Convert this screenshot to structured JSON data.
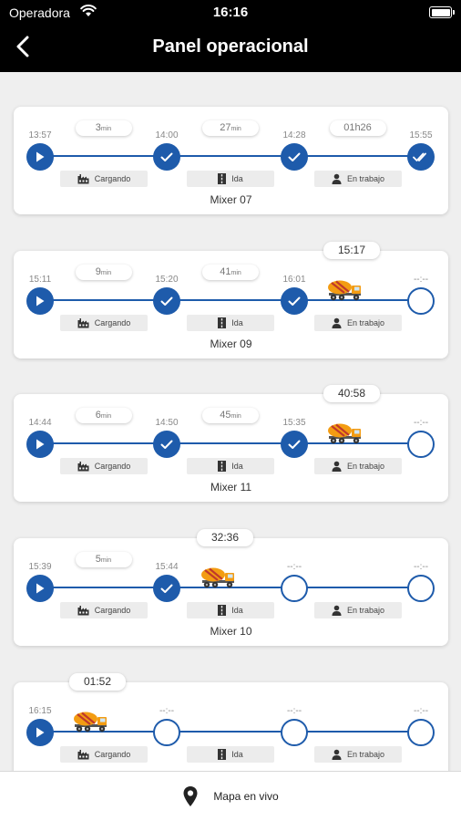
{
  "status_bar": {
    "carrier": "Operadora",
    "time": "16:16"
  },
  "header": {
    "title": "Panel operacional"
  },
  "cards": [
    {
      "mixer": "Mixer 07",
      "eta": "",
      "truck_stage": null,
      "times": [
        "13:57",
        "14:00",
        "14:28",
        "15:55"
      ],
      "durations": [
        {
          "value": "3",
          "unit": "min"
        },
        {
          "value": "27",
          "unit": "min"
        },
        {
          "value": "01h26",
          "unit": ""
        }
      ],
      "nodes": [
        "play",
        "check",
        "check",
        "double-check"
      ],
      "stages": [
        "Cargando",
        "Ida",
        "En trabajo"
      ]
    },
    {
      "mixer": "Mixer 09",
      "eta": "15:17",
      "truck_stage": 2,
      "times": [
        "15:11",
        "15:20",
        "16:01",
        "--:--"
      ],
      "durations": [
        {
          "value": "9",
          "unit": "min"
        },
        {
          "value": "41",
          "unit": "min"
        }
      ],
      "nodes": [
        "play",
        "check",
        "check",
        "empty"
      ],
      "stages": [
        "Cargando",
        "Ida",
        "En trabajo"
      ]
    },
    {
      "mixer": "Mixer 11",
      "eta": "40:58",
      "truck_stage": 2,
      "times": [
        "14:44",
        "14:50",
        "15:35",
        "--:--"
      ],
      "durations": [
        {
          "value": "6",
          "unit": "min"
        },
        {
          "value": "45",
          "unit": "min"
        }
      ],
      "nodes": [
        "play",
        "check",
        "check",
        "empty"
      ],
      "stages": [
        "Cargando",
        "Ida",
        "En trabajo"
      ]
    },
    {
      "mixer": "Mixer 10",
      "eta": "32:36",
      "truck_stage": 1,
      "times": [
        "15:39",
        "15:44",
        "--:--",
        "--:--"
      ],
      "durations": [
        {
          "value": "5",
          "unit": "min"
        }
      ],
      "nodes": [
        "play",
        "check",
        "empty",
        "empty"
      ],
      "stages": [
        "Cargando",
        "Ida",
        "En trabajo"
      ]
    },
    {
      "mixer": "",
      "eta": "01:52",
      "truck_stage": 0,
      "times": [
        "16:15",
        "--:--",
        "--:--",
        "--:--"
      ],
      "durations": [],
      "nodes": [
        "play",
        "empty",
        "empty",
        "empty"
      ],
      "stages": [
        "Cargando",
        "Ida",
        "En trabajo"
      ]
    }
  ],
  "bottom_bar": {
    "label": "Mapa en vivo",
    "icon": "map-pin-icon"
  },
  "colors": {
    "accent": "#1e5bab",
    "header_bg": "#000000",
    "truck": "#f39c12"
  }
}
